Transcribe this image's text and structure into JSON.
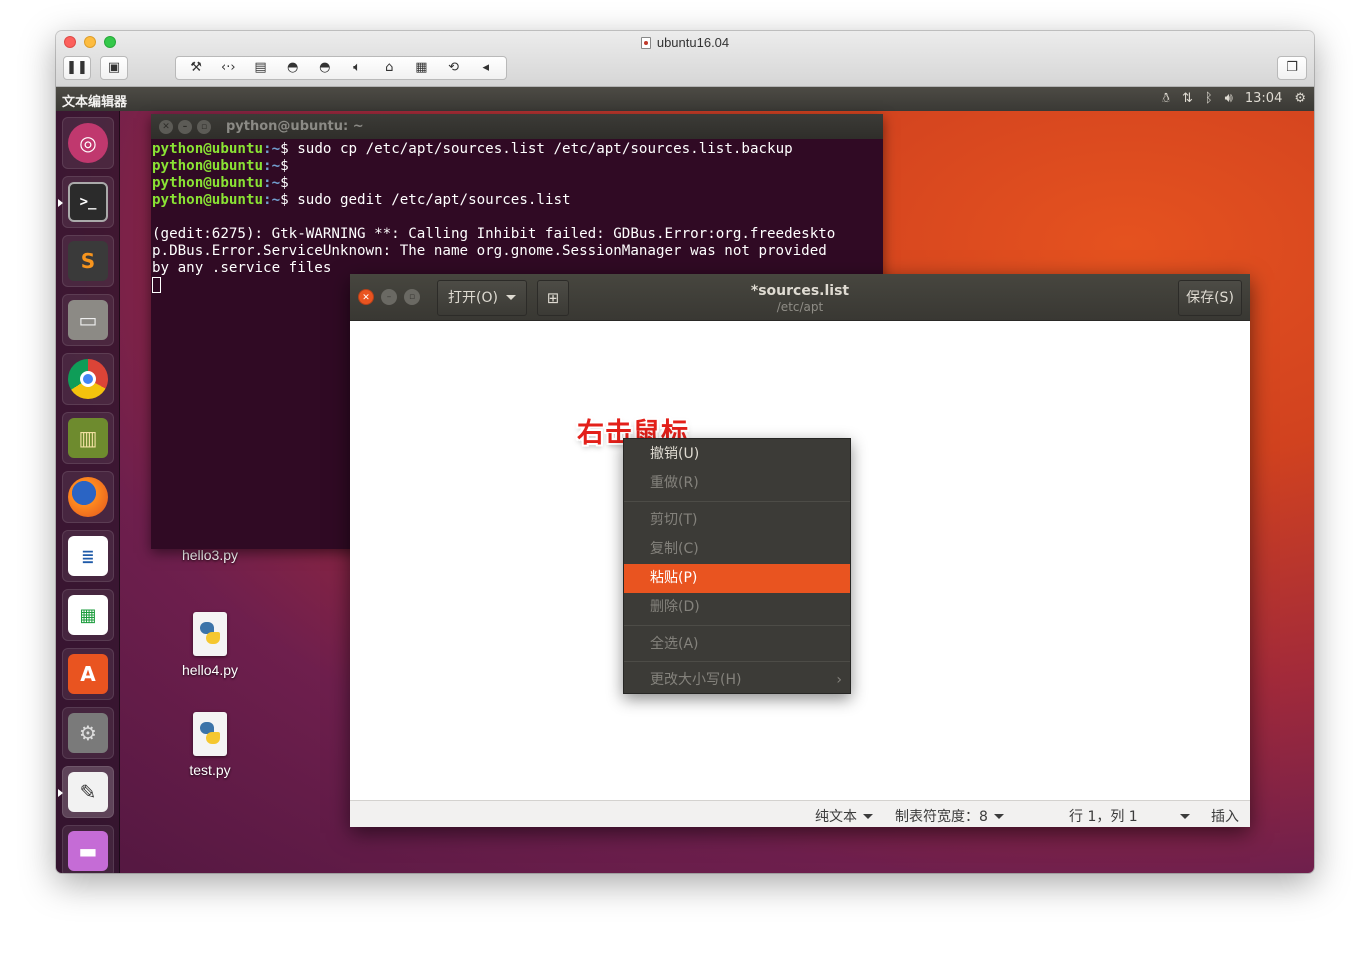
{
  "vm": {
    "title": "ubuntu16.04",
    "toolbar_icons": [
      "wrench-icon",
      "code-arrows-icon",
      "hard-disk-icon",
      "cd-icon",
      "cd-icon",
      "speaker-icon",
      "usb-icon",
      "floppy-icon",
      "refresh-icon",
      "left-arrow-icon"
    ]
  },
  "panel": {
    "title": "文本编辑器",
    "clock": "13:04"
  },
  "launcher": {
    "items": [
      "ubuntu-dash",
      "terminal",
      "sublime-text",
      "file-manager",
      "chrome",
      "reader",
      "firefox",
      "libreoffice-writer",
      "libreoffice-calc",
      "software-center",
      "system-settings",
      "text-editor",
      "trash"
    ]
  },
  "desktop": {
    "icons": [
      {
        "label": "hello3.py"
      },
      {
        "label": "hello4.py"
      },
      {
        "label": "test.py"
      }
    ]
  },
  "terminal": {
    "title": "python@ubuntu: ~",
    "lines": [
      {
        "user": "python@ubuntu",
        "path": ":~",
        "dollar": "$ ",
        "cmd": "sudo cp /etc/apt/sources.list /etc/apt/sources.list.backup"
      },
      {
        "user": "python@ubuntu",
        "path": ":~",
        "dollar": "$",
        "cmd": ""
      },
      {
        "user": "python@ubuntu",
        "path": ":~",
        "dollar": "$",
        "cmd": ""
      },
      {
        "user": "python@ubuntu",
        "path": ":~",
        "dollar": "$ ",
        "cmd": "sudo gedit /etc/apt/sources.list"
      }
    ],
    "output": [
      "(gedit:6275): Gtk-WARNING **: Calling Inhibit failed: GDBus.Error:org.freedeskto",
      "p.DBus.Error.ServiceUnknown: The name org.gnome.SessionManager was not provided",
      "by any .service files"
    ]
  },
  "gedit": {
    "open_label": "打开(O)",
    "title": "*sources.list",
    "subtitle": "/etc/apt",
    "save_label": "保存(S)",
    "status": {
      "language": "纯文本",
      "tab_width": "制表符宽度：8",
      "position": "行 1，列 1",
      "mode": "插入"
    }
  },
  "annotation": "右击鼠标",
  "context_menu": {
    "items": [
      {
        "label": "撤销(U)",
        "state": "enabled"
      },
      {
        "label": "重做(R)",
        "state": "disabled"
      },
      {
        "label": "剪切(T)",
        "state": "disabled"
      },
      {
        "label": "复制(C)",
        "state": "disabled"
      },
      {
        "label": "粘贴(P)",
        "state": "active"
      },
      {
        "label": "删除(D)",
        "state": "disabled"
      },
      {
        "label": "全选(A)",
        "state": "disabled"
      },
      {
        "label": "更改大小写(H)",
        "state": "disabled"
      }
    ]
  },
  "colors": {
    "accent": "#e95420",
    "terminal_bg": "#300a24",
    "prompt_user": "#8ae234",
    "prompt_path": "#729fcf",
    "annotation": "#e3201a"
  }
}
